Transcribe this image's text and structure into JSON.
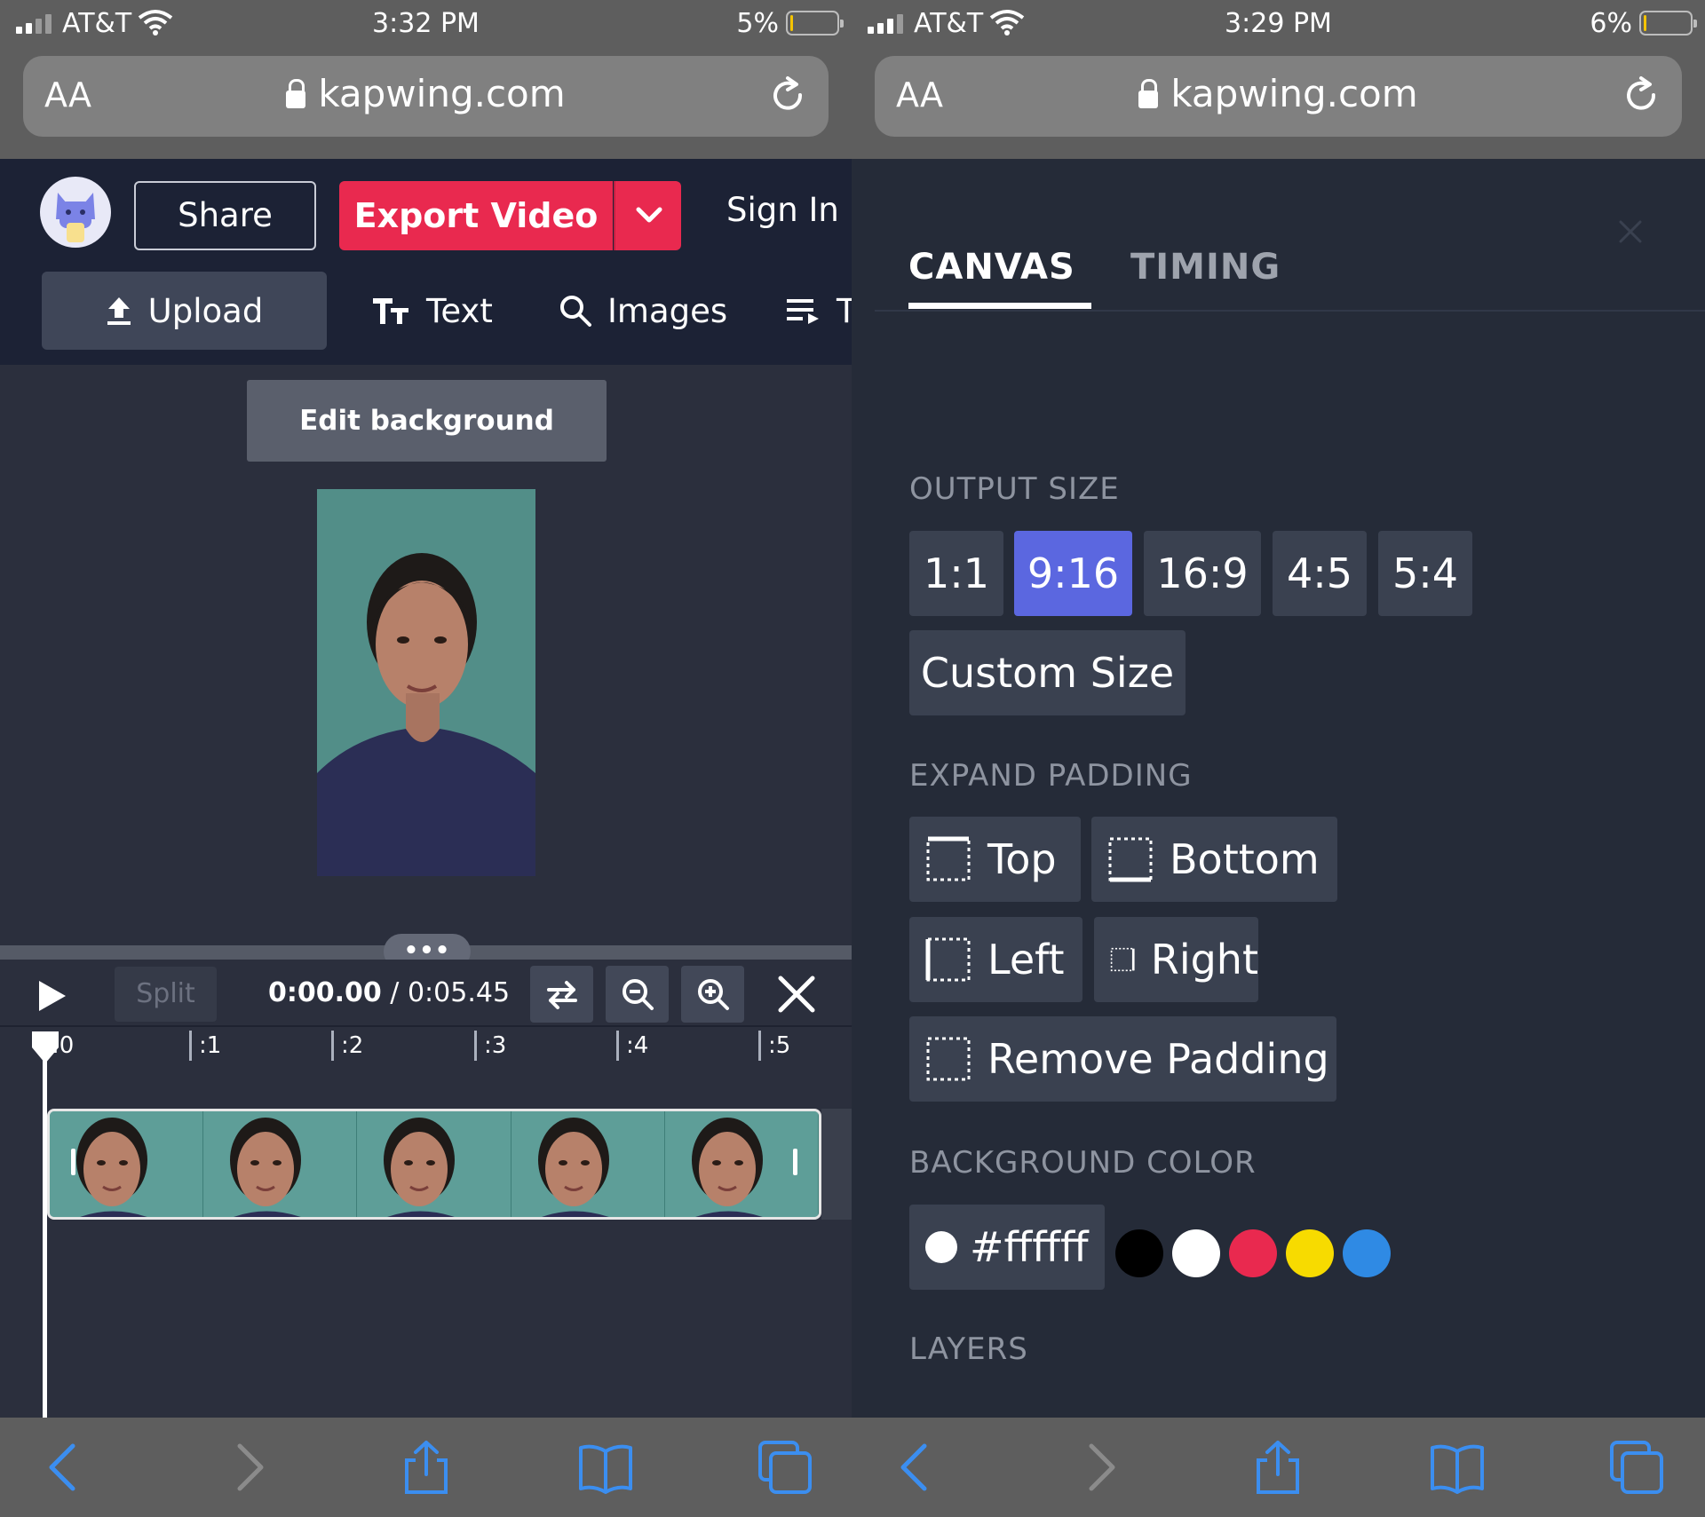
{
  "left": {
    "status": {
      "carrier": "AT&T",
      "time": "3:32 PM",
      "battery": "5%",
      "battery_level": 0.05
    },
    "url": {
      "text_size": "AA",
      "host": "kapwing.com"
    },
    "header": {
      "share": "Share",
      "export": "Export Video",
      "sign_in": "Sign In"
    },
    "tools": {
      "upload": "Upload",
      "text": "Text",
      "images": "Images",
      "more": "T"
    },
    "stage": {
      "edit_background": "Edit background"
    },
    "timeline": {
      "handle": "•••",
      "split": "Split",
      "current_time": "0:00.00",
      "separator": " / ",
      "total_time": "0:05.45",
      "ticks": [
        ":0",
        ":1",
        ":2",
        ":3",
        ":4",
        ":5"
      ],
      "frames": 5
    }
  },
  "right": {
    "status": {
      "carrier": "AT&T",
      "time": "3:29 PM",
      "battery": "6%",
      "battery_level": 0.06
    },
    "url": {
      "text_size": "AA",
      "host": "kapwing.com"
    },
    "tabs": {
      "canvas": "CANVAS",
      "timing": "TIMING"
    },
    "output_size": {
      "title": "OUTPUT SIZE",
      "options": [
        "1:1",
        "9:16",
        "16:9",
        "4:5",
        "5:4"
      ],
      "selected": "9:16",
      "custom": "Custom Size"
    },
    "padding": {
      "title": "EXPAND PADDING",
      "top": "Top",
      "bottom": "Bottom",
      "left": "Left",
      "right": "Right",
      "remove": "Remove Padding"
    },
    "background": {
      "title": "BACKGROUND COLOR",
      "value": "#ffffff",
      "swatches": [
        "#000000",
        "#ffffff",
        "#e9294f",
        "#f7db00",
        "#2f8ae4"
      ]
    },
    "layers": {
      "title": "LAYERS"
    }
  },
  "colors": {
    "accent": "#e9294f",
    "selected": "#5b67e0",
    "header_bg": "#1c2235"
  }
}
